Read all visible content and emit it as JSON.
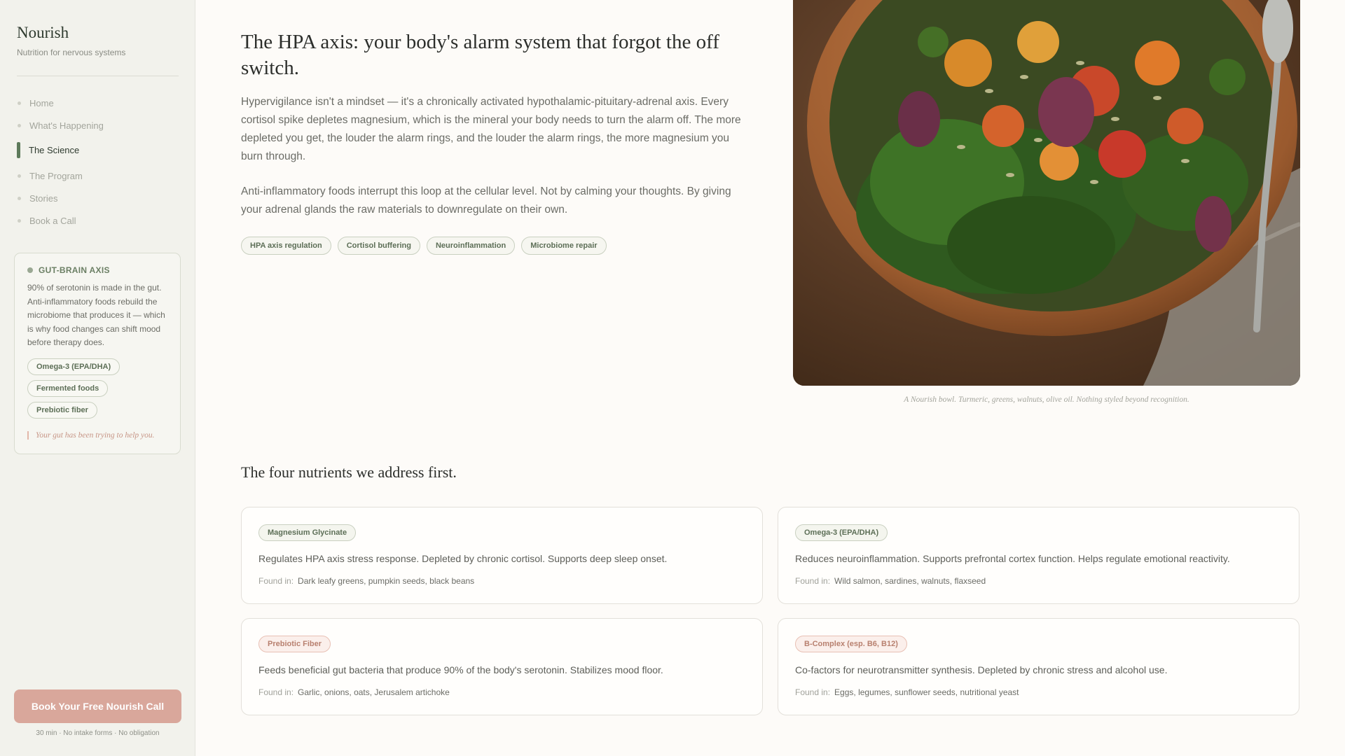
{
  "brand": {
    "name": "Nourish",
    "tagline": "Nutrition for nervous systems"
  },
  "nav": [
    {
      "label": "Home",
      "active": false
    },
    {
      "label": "What's Happening",
      "active": false
    },
    {
      "label": "The Science",
      "active": true
    },
    {
      "label": "The Program",
      "active": false
    },
    {
      "label": "Stories",
      "active": false
    },
    {
      "label": "Book a Call",
      "active": false
    }
  ],
  "sidebar_card": {
    "heading": "GUT-BRAIN AXIS",
    "body": "90% of serotonin is made in the gut. Anti-inflammatory foods rebuild the microbiome that produces it — which is why food changes can shift mood before therapy does.",
    "pills": [
      "Omega-3 (EPA/DHA)",
      "Fermented foods",
      "Prebiotic fiber"
    ],
    "quote": "Your gut has been trying to help you."
  },
  "cta": {
    "button": "Book Your Free Nourish Call",
    "subtext": "30 min · No intake forms · No obligation"
  },
  "main": {
    "title": "The HPA axis: your body's alarm system that forgot the off switch.",
    "paragraph1": "Hypervigilance isn't a mindset — it's a chronically activated hypothalamic-pituitary-adrenal axis. Every cortisol spike depletes magnesium, which is the mineral your body needs to turn the alarm off. The more depleted you get, the louder the alarm rings, and the louder the alarm rings, the more magnesium you burn through.",
    "paragraph2": "Anti-inflammatory foods interrupt this loop at the cellular level. Not by calming your thoughts. By giving your adrenal glands the raw materials to downregulate on their own.",
    "tags": [
      "HPA axis regulation",
      "Cortisol buffering",
      "Neuroinflammation",
      "Microbiome repair"
    ],
    "image_caption": "A Nourish bowl. Turmeric, greens, walnuts, olive oil. Nothing styled beyond recognition.",
    "section_title": "The four nutrients we address first.",
    "found_label": "Found in:",
    "nutrients": [
      {
        "name": "Magnesium Glycinate",
        "tone": "green",
        "description": "Regulates HPA axis stress response. Depleted by chronic cortisol. Supports deep sleep onset.",
        "found": "Dark leafy greens, pumpkin seeds, black beans"
      },
      {
        "name": "Omega-3 (EPA/DHA)",
        "tone": "green",
        "description": "Reduces neuroinflammation. Supports prefrontal cortex function. Helps regulate emotional reactivity.",
        "found": "Wild salmon, sardines, walnuts, flaxseed"
      },
      {
        "name": "Prebiotic Fiber",
        "tone": "rose",
        "description": "Feeds beneficial gut bacteria that produce 90% of the body's serotonin. Stabilizes mood floor.",
        "found": "Garlic, onions, oats, Jerusalem artichoke"
      },
      {
        "name": "B-Complex (esp. B6, B12)",
        "tone": "rose",
        "description": "Co-factors for neurotransmitter synthesis. Depleted by chronic stress and alcohol use.",
        "found": "Eggs, legumes, sunflower seeds, nutritional yeast"
      }
    ]
  },
  "colors": {
    "accent_green": "#5d7a5a",
    "cta_rose": "#d9a79b"
  }
}
